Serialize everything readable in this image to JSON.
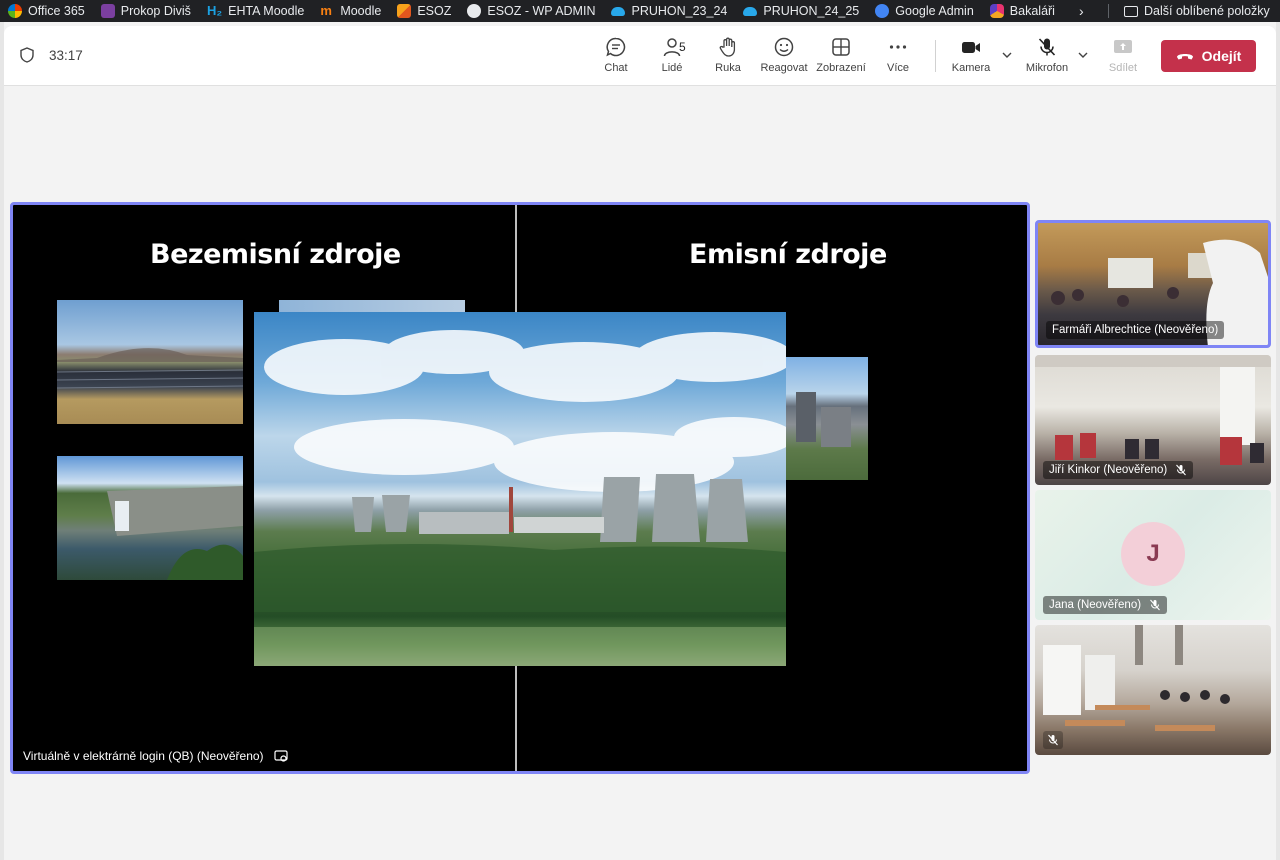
{
  "bookmarks": {
    "items": [
      {
        "label": "Office 365",
        "icon": "office-365-icon",
        "color": "#eb3c00"
      },
      {
        "label": "Prokop Diviš",
        "icon": "prokop-icon",
        "color": "#7b3fa0"
      },
      {
        "label": "EHTA Moodle",
        "icon": "h2-icon",
        "color": "#1ba1e2"
      },
      {
        "label": "Moodle",
        "icon": "moodle-icon",
        "color": "#f98012"
      },
      {
        "label": "ESOZ",
        "icon": "esoz-icon",
        "color": "#f26b21"
      },
      {
        "label": "ESOZ - WP ADMIN",
        "icon": "wordpress-icon",
        "color": "#e8eaed"
      },
      {
        "label": "PRUHON_23_24",
        "icon": "onedrive-icon",
        "color": "#28a8ea"
      },
      {
        "label": "PRUHON_24_25",
        "icon": "onedrive-icon",
        "color": "#28a8ea"
      },
      {
        "label": "Google Admin",
        "icon": "google-admin-icon",
        "color": "#4285f4"
      },
      {
        "label": "Bakaláři",
        "icon": "bakalari-icon",
        "color": "#e8336f"
      }
    ],
    "overflow": "›",
    "other": "Další oblíbené položky"
  },
  "meeting": {
    "timer": "33:17",
    "toolbar": {
      "chat": "Chat",
      "people": "Lidé",
      "people_count": "5",
      "raise": "Ruka",
      "react": "Reagovat",
      "view": "Zobrazení",
      "more": "Více",
      "camera": "Kamera",
      "mic": "Mikrofon",
      "share": "Sdílet",
      "leave": "Odejít"
    }
  },
  "stage": {
    "left_title": "Bezemisní zdroje",
    "right_title": "Emisní zdroje",
    "label": "Virtuálně v elektrárně login (QB) (Neověřeno)"
  },
  "participants": [
    {
      "name": "Farmáři Albrechtice (Neověřeno)",
      "muted": false
    },
    {
      "name": "Jiří Kinkor (Neověřeno)",
      "muted": true
    },
    {
      "name": "Jana (Neověřeno)",
      "muted": true,
      "initial": "J"
    },
    {
      "name": "",
      "muted": true
    }
  ],
  "colors": {
    "accent": "#7f85f5",
    "leave": "#c4314b"
  }
}
